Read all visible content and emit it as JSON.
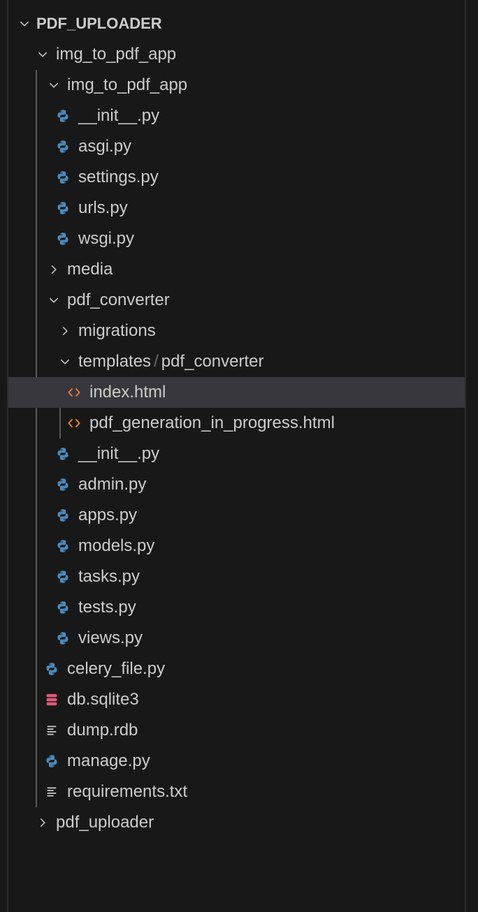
{
  "explorer": {
    "colors": {
      "python": "#4b8bbe",
      "html": "#e37933",
      "db": "#e05a7a",
      "text": "#cccccc",
      "selected_bg": "#37373d"
    },
    "rows": [
      {
        "label": "PDF_UPLOADER",
        "level": 0,
        "type": "folder",
        "open": true,
        "root": true
      },
      {
        "label": "img_to_pdf_app",
        "level": 1,
        "type": "folder",
        "open": true
      },
      {
        "label": "img_to_pdf_app",
        "level": 2,
        "type": "folder",
        "open": true
      },
      {
        "label": "__init__.py",
        "level": 3,
        "type": "python"
      },
      {
        "label": "asgi.py",
        "level": 3,
        "type": "python"
      },
      {
        "label": "settings.py",
        "level": 3,
        "type": "python"
      },
      {
        "label": "urls.py",
        "level": 3,
        "type": "python"
      },
      {
        "label": "wsgi.py",
        "level": 3,
        "type": "python"
      },
      {
        "label": "media",
        "level": 2,
        "type": "folder",
        "open": false
      },
      {
        "label": "pdf_converter",
        "level": 2,
        "type": "folder",
        "open": true
      },
      {
        "label": "migrations",
        "level": 3,
        "type": "folder",
        "open": false
      },
      {
        "label": "templates",
        "label2": "pdf_converter",
        "separator": "/",
        "level": 3,
        "type": "folder",
        "open": true
      },
      {
        "label": "index.html",
        "level": 4,
        "type": "html",
        "selected": true
      },
      {
        "label": "pdf_generation_in_progress.html",
        "level": 4,
        "type": "html"
      },
      {
        "label": "__init__.py",
        "level": 3,
        "type": "python"
      },
      {
        "label": "admin.py",
        "level": 3,
        "type": "python"
      },
      {
        "label": "apps.py",
        "level": 3,
        "type": "python"
      },
      {
        "label": "models.py",
        "level": 3,
        "type": "python"
      },
      {
        "label": "tasks.py",
        "level": 3,
        "type": "python"
      },
      {
        "label": "tests.py",
        "level": 3,
        "type": "python"
      },
      {
        "label": "views.py",
        "level": 3,
        "type": "python"
      },
      {
        "label": "celery_file.py",
        "level": 2,
        "type": "python"
      },
      {
        "label": "db.sqlite3",
        "level": 2,
        "type": "database"
      },
      {
        "label": "dump.rdb",
        "level": 2,
        "type": "text"
      },
      {
        "label": "manage.py",
        "level": 2,
        "type": "python"
      },
      {
        "label": "requirements.txt",
        "level": 2,
        "type": "text"
      },
      {
        "label": "pdf_uploader",
        "level": 1,
        "type": "folder",
        "open": false
      }
    ]
  }
}
